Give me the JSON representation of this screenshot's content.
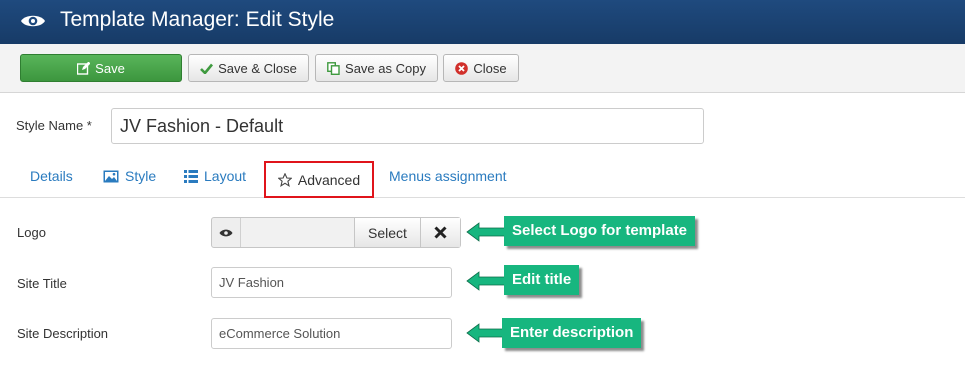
{
  "header": {
    "title": "Template Manager: Edit Style",
    "icon": "eye-icon"
  },
  "toolbar": {
    "save_label": "Save",
    "save_close_label": "Save & Close",
    "save_copy_label": "Save as Copy",
    "close_label": "Close"
  },
  "form": {
    "style_name_label": "Style Name *",
    "style_name_value": "JV Fashion - Default"
  },
  "tabs": [
    {
      "label": "Details",
      "icon": ""
    },
    {
      "label": "Style",
      "icon": "image-icon"
    },
    {
      "label": "Layout",
      "icon": "list-icon"
    },
    {
      "label": "Advanced",
      "icon": "star-outline-icon",
      "active": true
    },
    {
      "label": "Menus assignment",
      "icon": ""
    }
  ],
  "advanced": {
    "logo_label": "Logo",
    "logo_select_label": "Select",
    "site_title_label": "Site Title",
    "site_title_value": "JV Fashion",
    "site_description_label": "Site Description",
    "site_description_value": "eCommerce Solution"
  },
  "annotations": {
    "logo": "Select Logo for template",
    "title": "Edit title",
    "description": "Enter description"
  },
  "colors": {
    "header": "#1f4a7e",
    "save_button": "#4aa84b",
    "link": "#2a7bbf",
    "highlight_box": "#e0141b",
    "callout": "#17b67f"
  }
}
